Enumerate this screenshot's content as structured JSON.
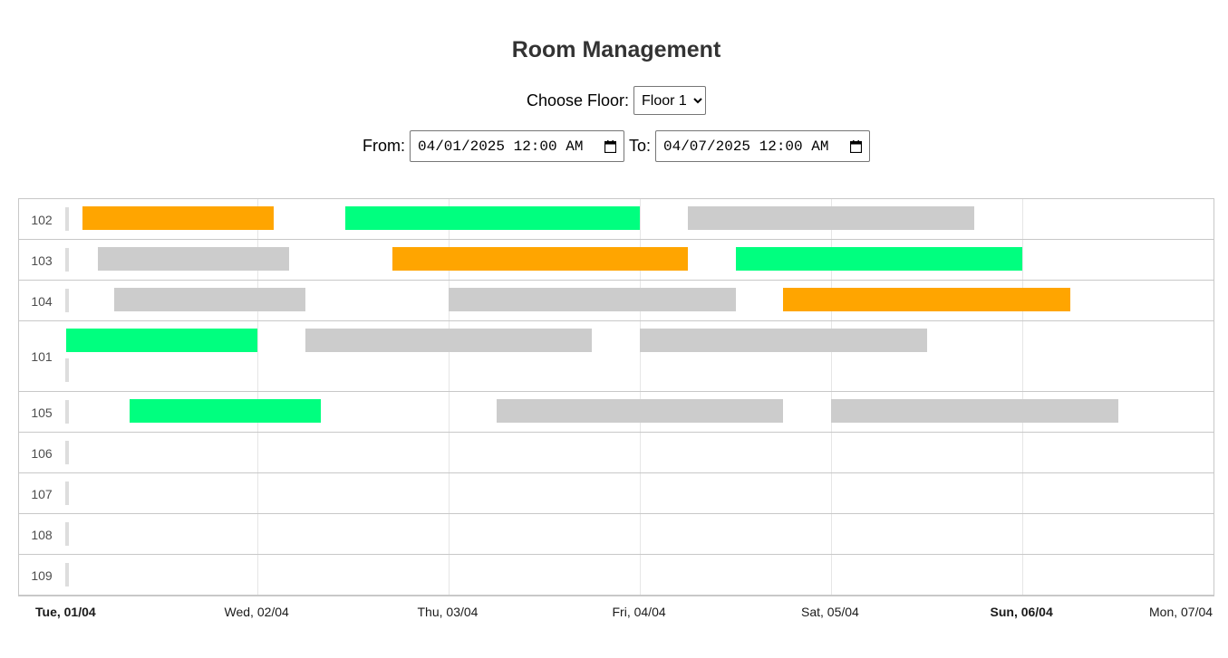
{
  "title": "Room Management",
  "floor": {
    "label": "Choose Floor:",
    "selected": "Floor 1",
    "chevron": "chevron-down-icon"
  },
  "range": {
    "from_label": "From:",
    "from_value": "04/01/2025 12:00 AM",
    "to_label": "To:",
    "to_value": "04/07/2025 12:00 AM",
    "icon": "calendar-icon"
  },
  "colors": {
    "orange": "#ffa500",
    "green": "#00ff7f",
    "gray": "#cccccc"
  },
  "timeline": {
    "start": "2025-04-01T00:00",
    "end": "2025-04-07T00:00",
    "axis_labels": [
      {
        "text": "Tue, 01/04",
        "major": true
      },
      {
        "text": "Wed, 02/04",
        "major": false
      },
      {
        "text": "Thu, 03/04",
        "major": false
      },
      {
        "text": "Fri, 04/04",
        "major": false
      },
      {
        "text": "Sat, 05/04",
        "major": false
      },
      {
        "text": "Sun, 06/04",
        "major": true
      },
      {
        "text": "Mon, 07/04",
        "major": false
      }
    ],
    "rooms": [
      {
        "name": "102",
        "tall": false,
        "bookings": [
          {
            "start": "2025-04-01T02:00",
            "end": "2025-04-02T02:00",
            "color": "orange"
          },
          {
            "start": "2025-04-02T11:00",
            "end": "2025-04-04T00:00",
            "color": "green"
          },
          {
            "start": "2025-04-04T06:00",
            "end": "2025-04-05T18:00",
            "color": "gray"
          }
        ]
      },
      {
        "name": "103",
        "tall": false,
        "bookings": [
          {
            "start": "2025-04-01T04:00",
            "end": "2025-04-02T04:00",
            "color": "gray"
          },
          {
            "start": "2025-04-02T17:00",
            "end": "2025-04-04T06:00",
            "color": "orange"
          },
          {
            "start": "2025-04-04T12:00",
            "end": "2025-04-06T00:00",
            "color": "green"
          }
        ]
      },
      {
        "name": "104",
        "tall": false,
        "bookings": [
          {
            "start": "2025-04-01T06:00",
            "end": "2025-04-02T06:00",
            "color": "gray"
          },
          {
            "start": "2025-04-03T00:00",
            "end": "2025-04-04T12:00",
            "color": "gray"
          },
          {
            "start": "2025-04-04T18:00",
            "end": "2025-04-06T06:00",
            "color": "orange"
          }
        ]
      },
      {
        "name": "101",
        "tall": true,
        "bookings": [
          {
            "start": "2025-04-01T00:00",
            "end": "2025-04-02T00:00",
            "color": "green"
          },
          {
            "start": "2025-04-02T06:00",
            "end": "2025-04-03T18:00",
            "color": "gray"
          },
          {
            "start": "2025-04-04T00:00",
            "end": "2025-04-05T12:00",
            "color": "gray"
          }
        ]
      },
      {
        "name": "105",
        "tall": false,
        "bookings": [
          {
            "start": "2025-04-01T08:00",
            "end": "2025-04-02T08:00",
            "color": "green"
          },
          {
            "start": "2025-04-03T06:00",
            "end": "2025-04-04T18:00",
            "color": "gray"
          },
          {
            "start": "2025-04-05T00:00",
            "end": "2025-04-06T12:00",
            "color": "gray"
          }
        ]
      },
      {
        "name": "106",
        "tall": false,
        "bookings": []
      },
      {
        "name": "107",
        "tall": false,
        "bookings": []
      },
      {
        "name": "108",
        "tall": false,
        "bookings": []
      },
      {
        "name": "109",
        "tall": false,
        "bookings": []
      }
    ]
  }
}
